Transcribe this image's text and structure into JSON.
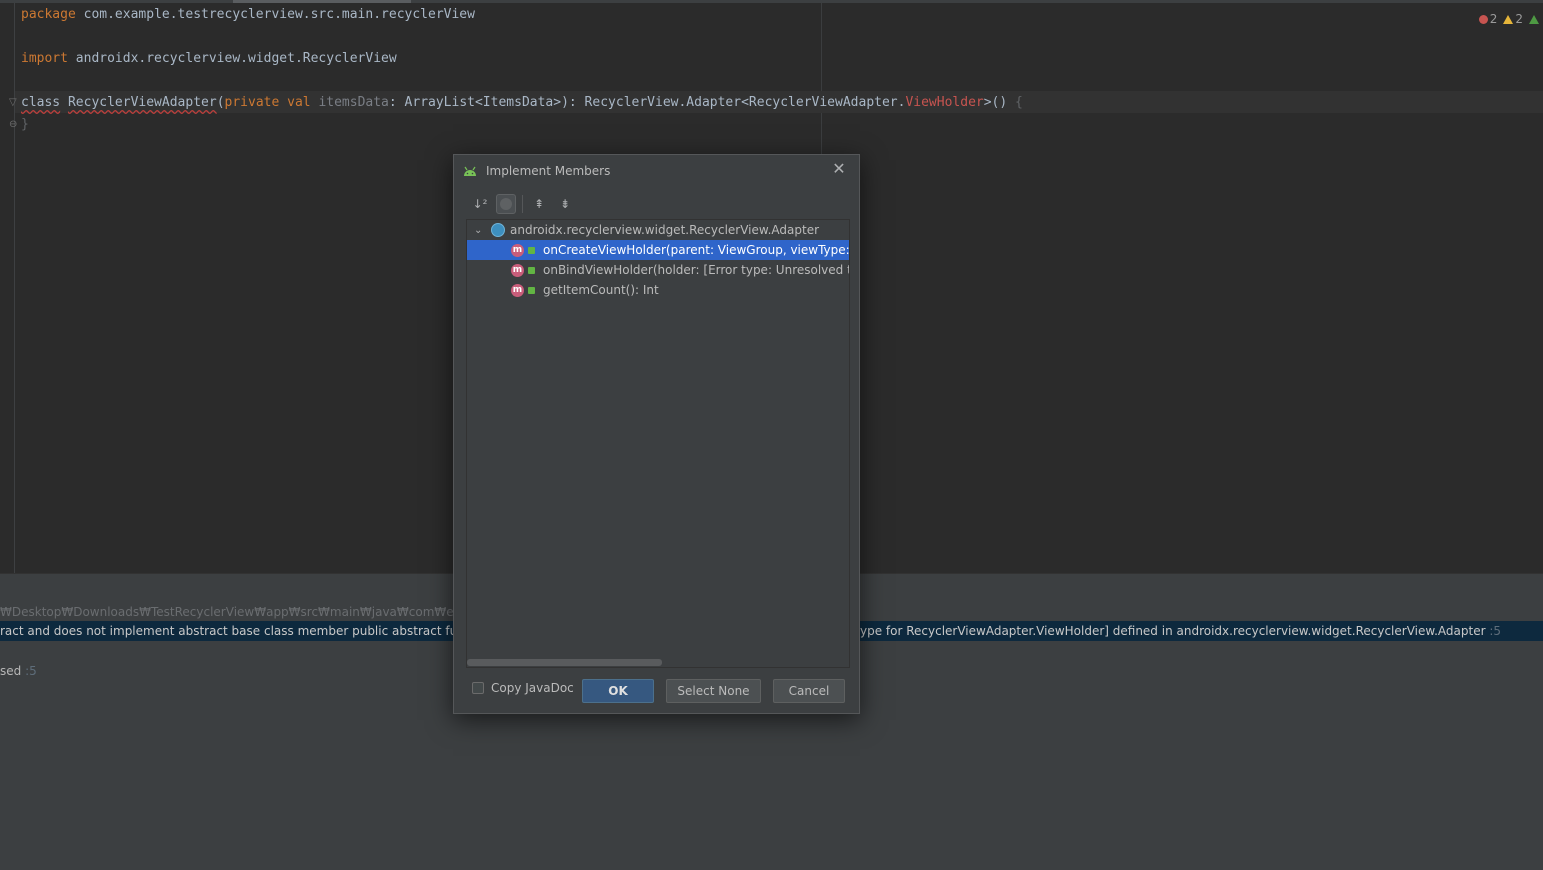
{
  "editor": {
    "line1": {
      "keyword": "package",
      "text": " com.example.testrecyclerview.src.main.recyclerView"
    },
    "line2": {
      "keyword": "import",
      "text": " androidx.recyclerview.widget.RecyclerView"
    },
    "line3": {
      "kw_class": "class",
      "class_name": "RecyclerViewAdapter",
      "paren_open": "(",
      "kw_private_val": "private val",
      "param_name": "itemsData",
      "type_part": ": ArrayList<ItemsData>): RecyclerView.Adapter<RecyclerViewAdapter.",
      "viewholder": "ViewHolder",
      "tail": ">() ",
      "brace": "{"
    },
    "line4": "}",
    "inspections": {
      "errors": "2",
      "warnings": "2"
    }
  },
  "panel": {
    "path": "₩Desktop₩Downloads₩TestRecyclerView₩app₩src₩main₩java₩com₩example₩te",
    "message_left": "ract and does not implement abstract base class member public abstract fun onCre",
    "message_right": "ype for RecyclerViewAdapter.ViewHolder] defined in androidx.recyclerview.widget.RecyclerView.Adapter",
    "message_right_suffix": " :5",
    "sed": "sed",
    "sed_suffix": " :5"
  },
  "dialog": {
    "title": "Implement Members",
    "tree": {
      "root": "androidx.recyclerview.widget.RecyclerView.Adapter",
      "items": [
        {
          "label": "onCreateViewHolder(parent: ViewGroup, viewType: Int):"
        },
        {
          "label": "onBindViewHolder(holder: [Error type: Unresolved type f"
        },
        {
          "label": "getItemCount(): Int"
        }
      ]
    },
    "copy_javadoc": "Copy JavaDoc",
    "ok": "OK",
    "select_none": "Select None",
    "cancel": "Cancel"
  },
  "colors": {
    "selection": "#2f65ca",
    "ok_button": "#365880",
    "keyword": "#cc7832",
    "error": "#c75450"
  }
}
